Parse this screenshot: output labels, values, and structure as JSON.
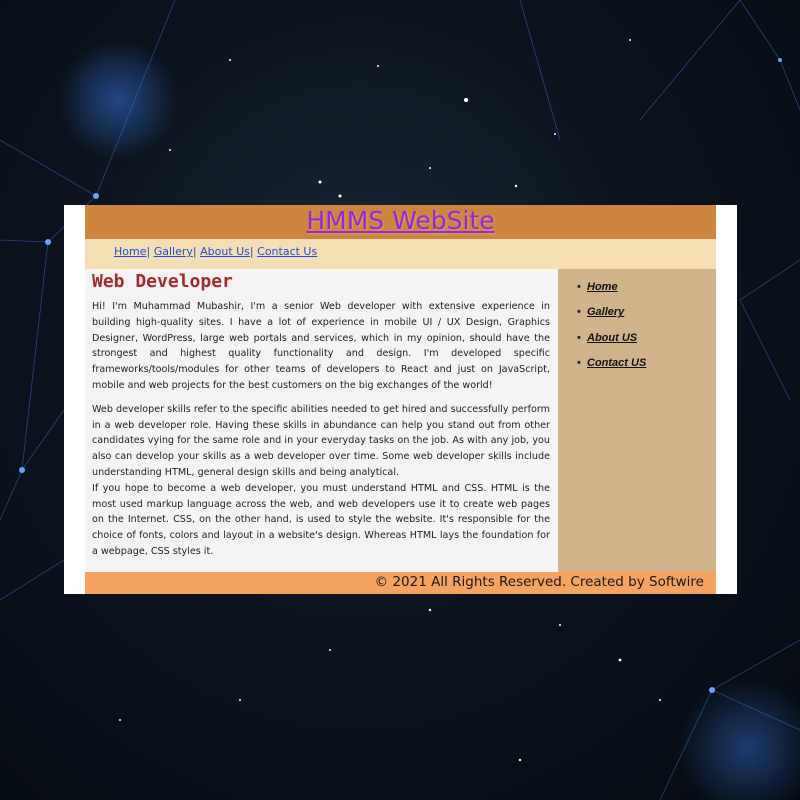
{
  "site": {
    "title": "HMMS WebSite"
  },
  "topnav": {
    "items": [
      "Home",
      "Gallery",
      "About Us",
      "Contact Us"
    ],
    "separator": "|"
  },
  "main": {
    "heading": "Web Developer",
    "paragraphs": [
      "Hi! I'm Muhammad Mubashir, I'm a senior Web developer with extensive experience in building high-quality sites. I have a lot of experience in mobile UI / UX Design, Graphics Designer, WordPress, large web portals and services, which in my opinion, should have the strongest and highest quality functionality and design. I'm developed specific frameworks/tools/modules for other teams of developers to React and just on JavaScript, mobile and web projects for the best customers on the big exchanges of the world!",
      "Web developer skills refer to the specific abilities needed to get hired and successfully perform in a web developer role. Having these skills in abundance can help you stand out from other candidates vying for the same role and in your everyday tasks on the job. As with any job, you also can develop your skills as a web developer over time. Some web developer skills include understanding HTML, general design skills and being analytical.",
      "If you hope to become a web developer, you must understand HTML and CSS. HTML is the most used markup language across the web, and web developers use it to create web pages on the Internet. CSS, on the other hand, is used to style the website. It's responsible for the choice of fonts, colors and layout in a website's design. Whereas HTML lays the foundation for a webpage, CSS styles it."
    ]
  },
  "sidebar": {
    "items": [
      "Home",
      "Gallery",
      "About US",
      "Contact US"
    ]
  },
  "footer": {
    "text": "© 2021 All Rights Reserved. Created by Softwire"
  },
  "colors": {
    "header": "#cd853f",
    "title": "#8a2be2",
    "topnav": "#f5deb3",
    "heading": "#a52a2a",
    "sidebar": "#d2b48c",
    "footer": "#f4a460",
    "backdrop": "#0c1420"
  }
}
